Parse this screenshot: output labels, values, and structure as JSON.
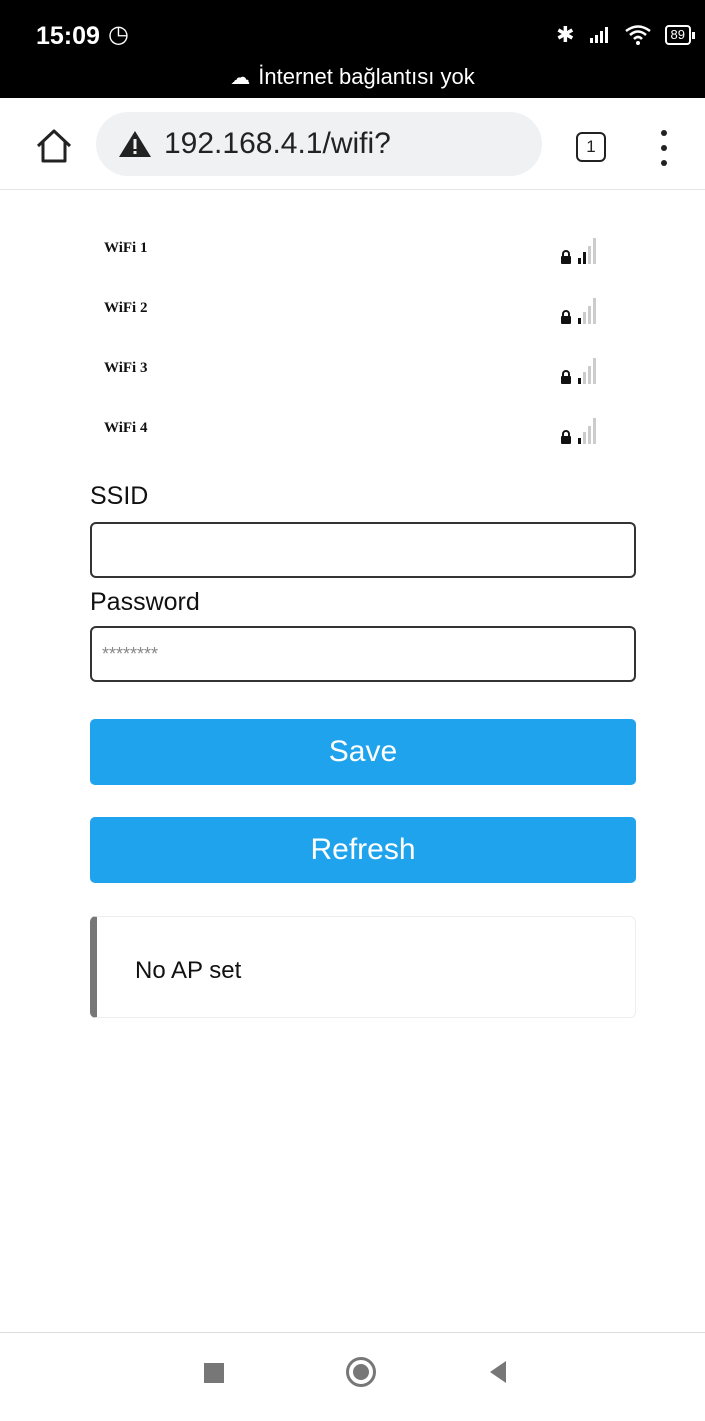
{
  "status_bar": {
    "time": "15:09",
    "network_notice": "İnternet bağlantısı yok",
    "battery": "89"
  },
  "browser": {
    "url": "192.168.4.1/wifi?",
    "tab_count": "1"
  },
  "wifi_networks": [
    {
      "name": "WiFi 1",
      "secured": true,
      "signal_bars": 2
    },
    {
      "name": "WiFi 2",
      "secured": true,
      "signal_bars": 1
    },
    {
      "name": "WiFi 3",
      "secured": true,
      "signal_bars": 1
    },
    {
      "name": "WiFi 4",
      "secured": true,
      "signal_bars": 1
    }
  ],
  "form": {
    "ssid_label": "SSID",
    "ssid_value": "",
    "password_label": "Password",
    "password_placeholder": "********",
    "save_label": "Save",
    "refresh_label": "Refresh"
  },
  "message": {
    "text": "No AP set"
  },
  "colors": {
    "button": "#1fa3ec",
    "message_border": "#777777"
  }
}
